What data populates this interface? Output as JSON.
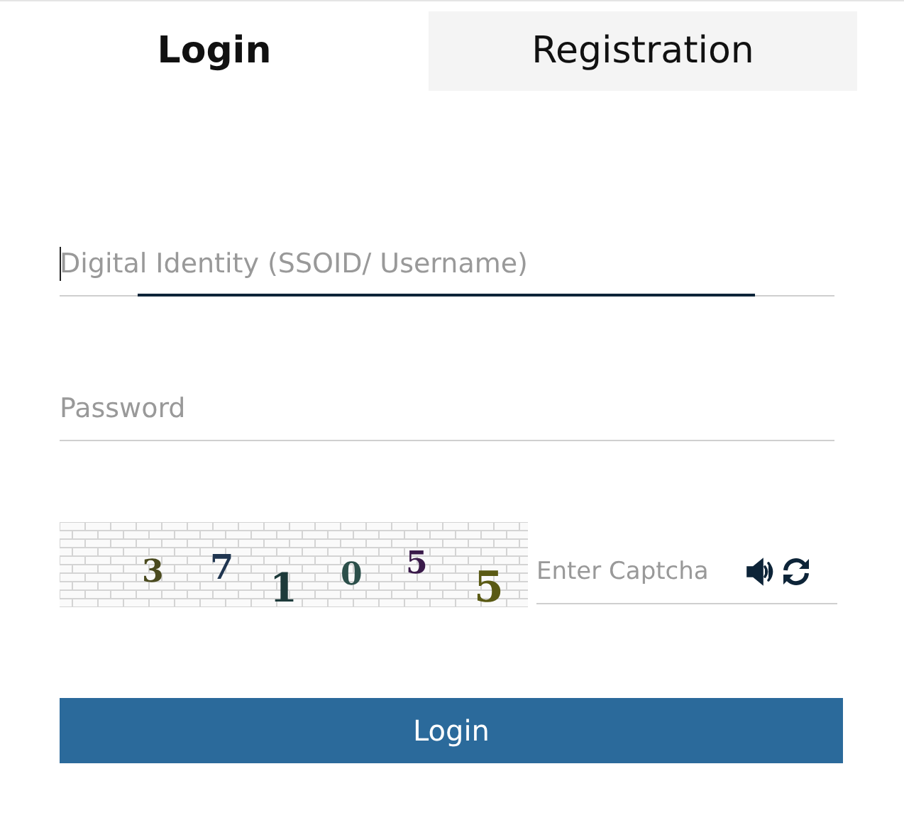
{
  "tabs": [
    {
      "label": "Login",
      "selected": true
    },
    {
      "label": "Registration",
      "selected": false
    }
  ],
  "fields": [
    {
      "placeholder": "Digital Identity (SSOID/ Username)",
      "focused": true
    },
    {
      "placeholder": "Password",
      "focused": false
    }
  ],
  "captcha": {
    "characters": [
      {
        "text": "3",
        "color": "#4a4a1e"
      },
      {
        "text": "7",
        "color": "#1f3550"
      },
      {
        "text": "1",
        "color": "#1d3a3a"
      },
      {
        "text": "0",
        "color": "#2c4f4a"
      },
      {
        "text": "5",
        "color": "#3a1a4a"
      },
      {
        "text": "5",
        "color": "#5a5a14"
      }
    ],
    "input_placeholder": "Enter Captcha"
  },
  "button": "Login"
}
